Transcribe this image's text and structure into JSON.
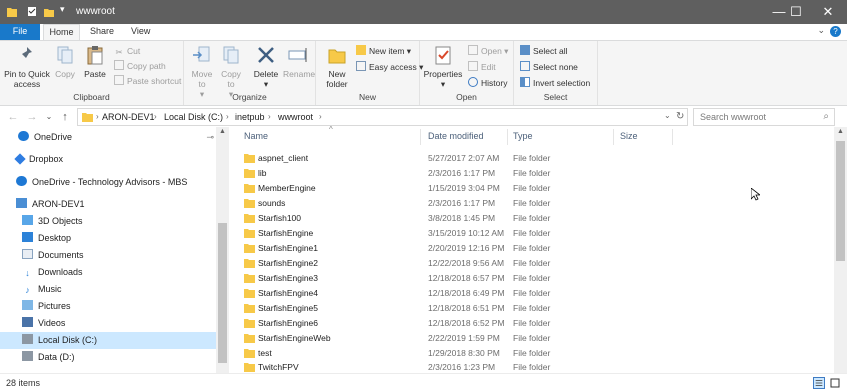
{
  "window": {
    "title": "wwwroot",
    "minimize": "—",
    "maximize": "☐",
    "close": "✕"
  },
  "ribbon_tabs": {
    "file": "File",
    "home": "Home",
    "share": "Share",
    "view": "View",
    "help": "?"
  },
  "ribbon": {
    "clipboard": {
      "label": "Clipboard",
      "pin": "Pin to Quick access",
      "copy": "Copy",
      "paste": "Paste",
      "cut": "Cut",
      "copy_path": "Copy path",
      "paste_shortcut": "Paste shortcut"
    },
    "organize": {
      "label": "Organize",
      "move_to": "Move to",
      "copy_to": "Copy to",
      "delete": "Delete",
      "rename": "Rename"
    },
    "new": {
      "label": "New",
      "new_folder": "New folder",
      "new_item": "New item",
      "easy_access": "Easy access"
    },
    "open": {
      "label": "Open",
      "properties": "Properties",
      "open": "Open",
      "edit": "Edit",
      "history": "History"
    },
    "select": {
      "label": "Select",
      "select_all": "Select all",
      "select_none": "Select none",
      "invert_selection": "Invert selection"
    }
  },
  "address": {
    "crumbs": [
      "ARON-DEV1",
      "Local Disk (C:)",
      "inetpub",
      "wwwroot"
    ],
    "search_placeholder": "Search wwwroot"
  },
  "nav_pane": {
    "items": [
      {
        "label": "OneDrive",
        "icon": "cloud-icon"
      },
      {
        "label": "Dropbox",
        "icon": "dropbox-icon"
      },
      {
        "label": "OneDrive - Technology Advisors - MBS",
        "icon": "cloud-icon"
      },
      {
        "label": "ARON-DEV1",
        "icon": "computer-icon"
      },
      {
        "label": "3D Objects",
        "icon": "3d-objects-icon"
      },
      {
        "label": "Desktop",
        "icon": "desktop-icon"
      },
      {
        "label": "Documents",
        "icon": "documents-icon"
      },
      {
        "label": "Downloads",
        "icon": "downloads-icon"
      },
      {
        "label": "Music",
        "icon": "music-icon"
      },
      {
        "label": "Pictures",
        "icon": "pictures-icon"
      },
      {
        "label": "Videos",
        "icon": "videos-icon"
      },
      {
        "label": "Local Disk (C:)",
        "icon": "disk-icon"
      },
      {
        "label": "Data (D:)",
        "icon": "disk-icon"
      }
    ],
    "selected": "Local Disk (C:)"
  },
  "columns": {
    "name": "Name",
    "date_modified": "Date modified",
    "type": "Type",
    "size": "Size"
  },
  "files": [
    {
      "name": "aspnet_client",
      "date": "5/27/2017 2:07 AM",
      "type": "File folder"
    },
    {
      "name": "lib",
      "date": "2/3/2016 1:17 PM",
      "type": "File folder"
    },
    {
      "name": "MemberEngine",
      "date": "1/15/2019 3:04 PM",
      "type": "File folder"
    },
    {
      "name": "sounds",
      "date": "2/3/2016 1:17 PM",
      "type": "File folder"
    },
    {
      "name": "Starfish100",
      "date": "3/8/2018 1:45 PM",
      "type": "File folder"
    },
    {
      "name": "StarfishEngine",
      "date": "3/15/2019 10:12 AM",
      "type": "File folder"
    },
    {
      "name": "StarfishEngine1",
      "date": "2/20/2019 12:16 PM",
      "type": "File folder"
    },
    {
      "name": "StarfishEngine2",
      "date": "12/22/2018 9:56 AM",
      "type": "File folder"
    },
    {
      "name": "StarfishEngine3",
      "date": "12/18/2018 6:57 PM",
      "type": "File folder"
    },
    {
      "name": "StarfishEngine4",
      "date": "12/18/2018 6:49 PM",
      "type": "File folder"
    },
    {
      "name": "StarfishEngine5",
      "date": "12/18/2018 6:51 PM",
      "type": "File folder"
    },
    {
      "name": "StarfishEngine6",
      "date": "12/18/2018 6:52 PM",
      "type": "File folder"
    },
    {
      "name": "StarfishEngineWeb",
      "date": "2/22/2019 1:59 PM",
      "type": "File folder"
    },
    {
      "name": "test",
      "date": "1/29/2018 8:30 PM",
      "type": "File folder"
    },
    {
      "name": "TwitchFPV",
      "date": "2/3/2016 1:23 PM",
      "type": "File folder"
    }
  ],
  "status": {
    "item_count": "28 items"
  },
  "colors": {
    "titlebar": "#5f5f5f",
    "folder": "#f7c948",
    "selection": "#cce8ff",
    "accent": "#1979ca"
  }
}
